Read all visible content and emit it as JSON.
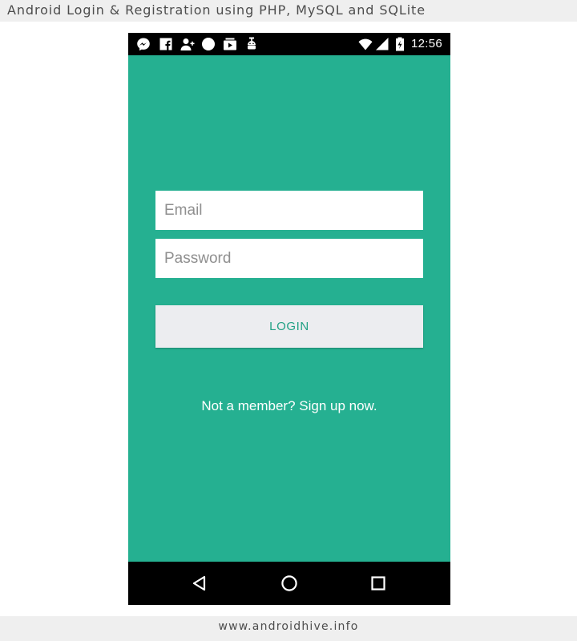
{
  "banner": {
    "title": "Android Login & Registration using PHP, MySQL and SQLite"
  },
  "status_bar": {
    "time": "12:56",
    "notification_icons": [
      "messenger-icon",
      "facebook-icon",
      "add-contact-icon",
      "circle-icon",
      "media-icon",
      "android-debug-icon"
    ],
    "system_icons": [
      "wifi-icon",
      "cell-signal-icon",
      "battery-charging-icon"
    ]
  },
  "login_form": {
    "email_placeholder": "Email",
    "email_value": "",
    "password_placeholder": "Password",
    "password_value": "",
    "login_label": "LOGIN",
    "signup_text": "Not a member? Sign up now."
  },
  "nav_bar": {
    "buttons": [
      "back-icon",
      "home-icon",
      "recents-icon"
    ]
  },
  "footer": {
    "url_text": "www.androidhive.info"
  },
  "colors": {
    "primary": "#25b091",
    "button_background": "#ecedf0",
    "button_text": "#22a185",
    "status_bar": "#000000"
  }
}
